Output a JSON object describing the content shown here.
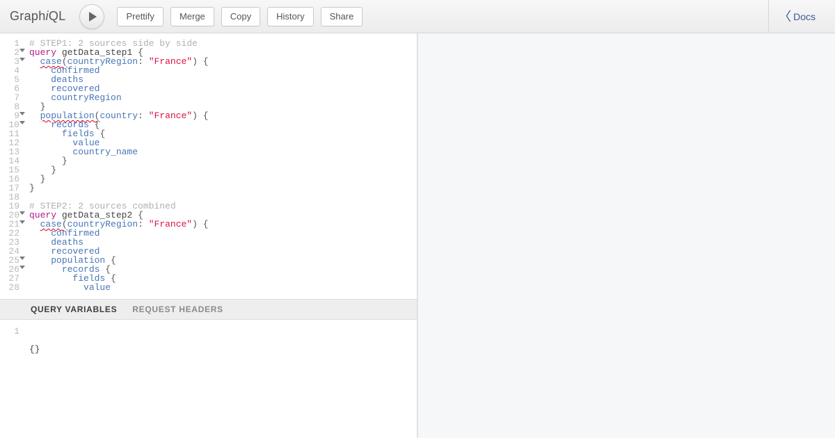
{
  "app": {
    "logo_graph": "Graph",
    "logo_i": "i",
    "logo_ql": "QL"
  },
  "toolbar": {
    "prettify": "Prettify",
    "merge": "Merge",
    "copy": "Copy",
    "history": "History",
    "share": "Share",
    "docs": "Docs"
  },
  "editor": {
    "lines": [
      {
        "n": 1,
        "fold": false,
        "tokens": [
          [
            "c-comment",
            "# STEP1: 2 sources side by side"
          ]
        ]
      },
      {
        "n": 2,
        "fold": true,
        "tokens": [
          [
            "c-kw",
            "query"
          ],
          [
            "",
            " "
          ],
          [
            "c-def",
            "getData_step1"
          ],
          [
            "",
            " "
          ],
          [
            "c-punc",
            "{"
          ]
        ]
      },
      {
        "n": 3,
        "fold": true,
        "tokens": [
          [
            "",
            "  "
          ],
          [
            "c-attr squiggle",
            "case"
          ],
          [
            "c-punc squiggle",
            "("
          ],
          [
            "c-attr",
            "countryRegion"
          ],
          [
            "c-punc",
            ":"
          ],
          [
            "",
            " "
          ],
          [
            "c-str",
            "\"France\""
          ],
          [
            "c-punc",
            ")"
          ],
          [
            "",
            " "
          ],
          [
            "c-punc",
            "{"
          ]
        ]
      },
      {
        "n": 4,
        "fold": false,
        "tokens": [
          [
            "",
            "    "
          ],
          [
            "c-attr",
            "confirmed"
          ]
        ]
      },
      {
        "n": 5,
        "fold": false,
        "tokens": [
          [
            "",
            "    "
          ],
          [
            "c-attr",
            "deaths"
          ]
        ]
      },
      {
        "n": 6,
        "fold": false,
        "tokens": [
          [
            "",
            "    "
          ],
          [
            "c-attr",
            "recovered"
          ]
        ]
      },
      {
        "n": 7,
        "fold": false,
        "tokens": [
          [
            "",
            "    "
          ],
          [
            "c-attr",
            "countryRegion"
          ]
        ]
      },
      {
        "n": 8,
        "fold": false,
        "tokens": [
          [
            "",
            "  "
          ],
          [
            "c-punc",
            "}"
          ]
        ]
      },
      {
        "n": 9,
        "fold": true,
        "tokens": [
          [
            "",
            "  "
          ],
          [
            "c-attr squiggle",
            "population"
          ],
          [
            "c-punc squiggle",
            "("
          ],
          [
            "c-attr",
            "country"
          ],
          [
            "c-punc",
            ":"
          ],
          [
            "",
            " "
          ],
          [
            "c-str",
            "\"France\""
          ],
          [
            "c-punc",
            ")"
          ],
          [
            "",
            " "
          ],
          [
            "c-punc",
            "{"
          ]
        ]
      },
      {
        "n": 10,
        "fold": true,
        "tokens": [
          [
            "",
            "    "
          ],
          [
            "c-attr",
            "records"
          ],
          [
            "",
            " "
          ],
          [
            "c-punc",
            "{"
          ]
        ]
      },
      {
        "n": 11,
        "fold": false,
        "tokens": [
          [
            "",
            "      "
          ],
          [
            "c-attr",
            "fields"
          ],
          [
            "",
            " "
          ],
          [
            "c-punc",
            "{"
          ]
        ]
      },
      {
        "n": 12,
        "fold": false,
        "tokens": [
          [
            "",
            "        "
          ],
          [
            "c-attr",
            "value"
          ]
        ]
      },
      {
        "n": 13,
        "fold": false,
        "tokens": [
          [
            "",
            "        "
          ],
          [
            "c-attr",
            "country_name"
          ]
        ]
      },
      {
        "n": 14,
        "fold": false,
        "tokens": [
          [
            "",
            "      "
          ],
          [
            "c-punc",
            "}"
          ]
        ]
      },
      {
        "n": 15,
        "fold": false,
        "tokens": [
          [
            "",
            "    "
          ],
          [
            "c-punc",
            "}"
          ]
        ]
      },
      {
        "n": 16,
        "fold": false,
        "tokens": [
          [
            "",
            "  "
          ],
          [
            "c-punc",
            "}"
          ]
        ]
      },
      {
        "n": 17,
        "fold": false,
        "tokens": [
          [
            "c-punc",
            "}"
          ]
        ]
      },
      {
        "n": 18,
        "fold": false,
        "tokens": [
          [
            "",
            ""
          ]
        ]
      },
      {
        "n": 19,
        "fold": false,
        "tokens": [
          [
            "c-comment",
            "# STEP2: 2 sources combined"
          ]
        ]
      },
      {
        "n": 20,
        "fold": true,
        "tokens": [
          [
            "c-kw",
            "query"
          ],
          [
            "",
            " "
          ],
          [
            "c-def",
            "getData_step2"
          ],
          [
            "",
            " "
          ],
          [
            "c-punc",
            "{"
          ]
        ]
      },
      {
        "n": 21,
        "fold": true,
        "tokens": [
          [
            "",
            "  "
          ],
          [
            "c-attr squiggle",
            "case"
          ],
          [
            "c-punc squiggle",
            "("
          ],
          [
            "c-attr",
            "countryRegion"
          ],
          [
            "c-punc",
            ":"
          ],
          [
            "",
            " "
          ],
          [
            "c-str",
            "\"France\""
          ],
          [
            "c-punc",
            ")"
          ],
          [
            "",
            " "
          ],
          [
            "c-punc",
            "{"
          ]
        ]
      },
      {
        "n": 22,
        "fold": false,
        "tokens": [
          [
            "",
            "    "
          ],
          [
            "c-attr",
            "confirmed"
          ]
        ]
      },
      {
        "n": 23,
        "fold": false,
        "tokens": [
          [
            "",
            "    "
          ],
          [
            "c-attr",
            "deaths"
          ]
        ]
      },
      {
        "n": 24,
        "fold": false,
        "tokens": [
          [
            "",
            "    "
          ],
          [
            "c-attr",
            "recovered"
          ]
        ]
      },
      {
        "n": 25,
        "fold": true,
        "tokens": [
          [
            "",
            "    "
          ],
          [
            "c-attr",
            "population"
          ],
          [
            "",
            " "
          ],
          [
            "c-punc",
            "{"
          ]
        ]
      },
      {
        "n": 26,
        "fold": true,
        "tokens": [
          [
            "",
            "      "
          ],
          [
            "c-attr",
            "records"
          ],
          [
            "",
            " "
          ],
          [
            "c-punc",
            "{"
          ]
        ]
      },
      {
        "n": 27,
        "fold": false,
        "tokens": [
          [
            "",
            "        "
          ],
          [
            "c-attr",
            "fields"
          ],
          [
            "",
            " "
          ],
          [
            "c-punc",
            "{"
          ]
        ]
      },
      {
        "n": 28,
        "fold": false,
        "tokens": [
          [
            "",
            "          "
          ],
          [
            "c-attr",
            "value"
          ]
        ]
      }
    ]
  },
  "tabs": {
    "query_variables": "Query Variables",
    "request_headers": "Request Headers"
  },
  "vars": {
    "line1_num": "1",
    "line1_text": "{}"
  }
}
